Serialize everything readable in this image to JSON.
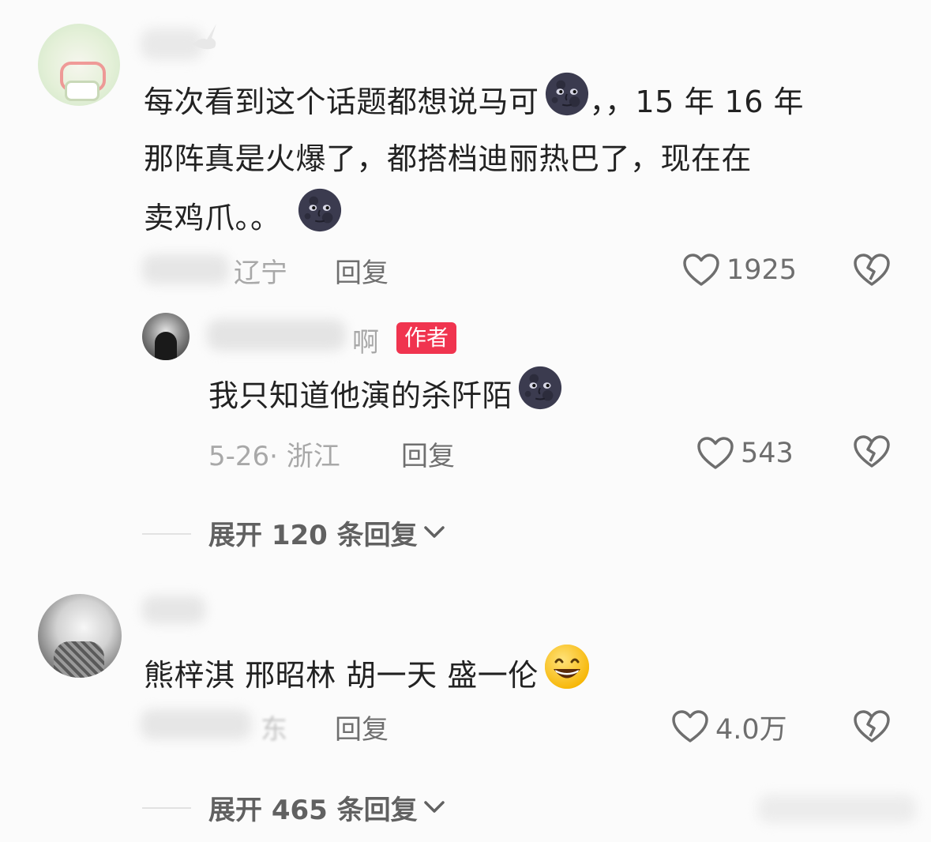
{
  "comments": [
    {
      "text": "每次看到这个话题都想说马可",
      "text_after_emoji": "，，15 年 16 年",
      "text_line2": "那阵真是火爆了，都搭档迪丽热巴了，现在在",
      "text_line3": "卖鸡爪。。",
      "location": "辽宁",
      "reply_label": "回复",
      "likes": "1925",
      "reply": {
        "name_suffix": "啊",
        "author_badge": "作者",
        "text": "我只知道他演的杀阡陌",
        "date_location": "5-26· 浙江",
        "reply_label": "回复",
        "likes": "543"
      },
      "expand_label": "展开 120 条回复"
    },
    {
      "text": "熊梓淇 邢昭林 胡一天 盛一伦",
      "location_partial": "东",
      "reply_label": "回复",
      "likes": "4.0万",
      "expand_label": "展开 465 条回复"
    }
  ],
  "icons": {
    "heart": "heart-outline-icon",
    "dislike": "broken-heart-icon",
    "moon": "new-moon-face-emoji",
    "grin": "grinning-squinting-face-emoji",
    "chevron": "chevron-down-icon"
  },
  "colors": {
    "badge": "#f0344f",
    "muted": "#a8a8a8",
    "text": "#222222"
  }
}
